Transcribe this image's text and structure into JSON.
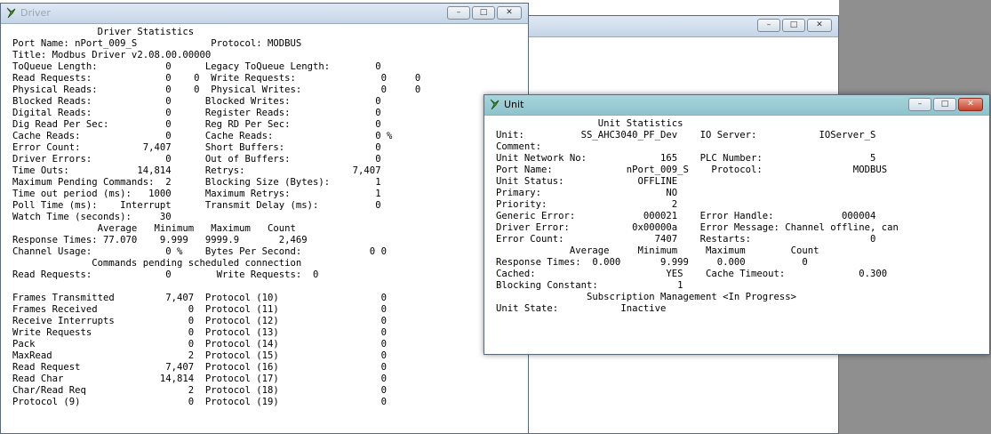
{
  "driver_window": {
    "title": "Driver",
    "lines": [
      "               Driver Statistics",
      "Port Name: nPort_009_S             Protocol: MODBUS",
      "Title: Modbus Driver v2.08.00.00000",
      "ToQueue Length:            0      Legacy ToQueue Length:        0",
      "Read Requests:             0    0  Write Requests:               0     0",
      "Physical Reads:            0    0  Physical Writes:              0     0",
      "Blocked Reads:             0      Blocked Writes:               0",
      "Digital Reads:             0      Register Reads:               0",
      "Dig Read Per Sec:          0      Reg RD Per Sec:               0",
      "Cache Reads:               0      Cache Reads:                  0 %",
      "Error Count:           7,407      Short Buffers:                0",
      "Driver Errors:             0      Out of Buffers:               0",
      "Time Outs:            14,814      Retrys:                   7,407",
      "Maximum Pending Commands:  2      Blocking Size (Bytes):        1",
      "Time out period (ms):   1000      Maximum Retrys:               1",
      "Poll Time (ms):    Interrupt      Transmit Delay (ms):          0",
      "Watch Time (seconds):     30",
      "               Average   Minimum   Maximum   Count",
      "Response Times: 77.070    9.999   9999.9       2,469",
      "Channel Usage:             0 %    Bytes Per Second:            0 0",
      "              Commands pending scheduled connection",
      "Read Requests:             0        Write Requests:  0",
      "",
      "Frames Transmitted         7,407  Protocol (10)                  0",
      "Frames Received                0  Protocol (11)                  0",
      "Receive Interrupts             0  Protocol (12)                  0",
      "Write Requests                 0  Protocol (13)                  0",
      "Pack                           0  Protocol (14)                  0",
      "MaxRead                        2  Protocol (15)                  0",
      "Read Request               7,407  Protocol (16)                  0",
      "Read Char                 14,814  Protocol (17)                  0",
      "Char/Read Req                  2  Protocol (18)                  0",
      "Protocol (9)                   0  Protocol (19)                  0"
    ]
  },
  "unit_window": {
    "title": "Unit",
    "lines": [
      "                  Unit Statistics",
      "Unit:          SS_AHC3040_PF_Dev    IO Server:           IOServer_S",
      "Comment:",
      "Unit Network No:             165    PLC Number:                   5",
      "Port Name:             nPort_009_S    Protocol:                MODBUS",
      "Unit Status:             OFFLINE",
      "Primary:                      NO",
      "Priority:                      2",
      "Generic Error:            000021    Error Handle:            000004",
      "Driver Error:           0x00000a    Error Message: Channel offline, can",
      "Error Count:                7407    Restarts:                     0",
      "             Average     Minimum     Maximum        Count",
      "Response Times:  0.000       9.999     0.000          0",
      "Cached:                       YES    Cache Timeout:             0.300",
      "Blocking Constant:              1",
      "                Subscription Management <In Progress>",
      "Unit State:           Inactive"
    ]
  },
  "window_controls": {
    "minimize": "–",
    "maximize": "□",
    "close": "✕"
  },
  "colors": {
    "active_titlebar": "#8ec3cc",
    "inactive_titlebar": "#c5d5e6",
    "close_button": "#c8432c",
    "desktop": "#8f8f8f"
  }
}
